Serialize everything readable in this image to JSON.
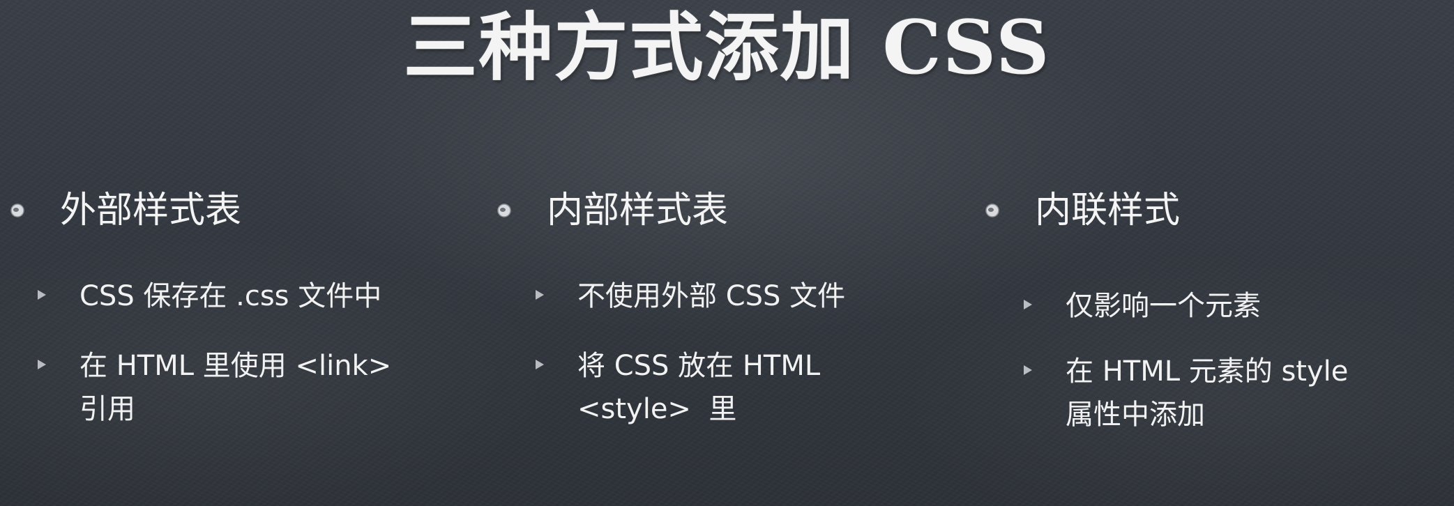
{
  "title": "三种方式添加 CSS",
  "columns": [
    {
      "heading": "外部样式表",
      "items": [
        "CSS 保存在 .css 文件中",
        "在 HTML 里使用 <link>\n引用"
      ]
    },
    {
      "heading": "内部样式表",
      "items": [
        "不使用外部 CSS 文件",
        "将 CSS 放在 HTML\n<style>  里"
      ]
    },
    {
      "heading": "内联样式",
      "items": [
        "仅影响一个元素",
        "在 HTML 元素的 style\n属性中添加"
      ]
    }
  ],
  "colors": {
    "background": "#353a42",
    "text": "#f2f2f2",
    "bullet": "#b9bcc1"
  },
  "icons": {
    "heading_bullet": "round-bullet-icon",
    "item_bullet": "triangle-bullet-icon"
  }
}
